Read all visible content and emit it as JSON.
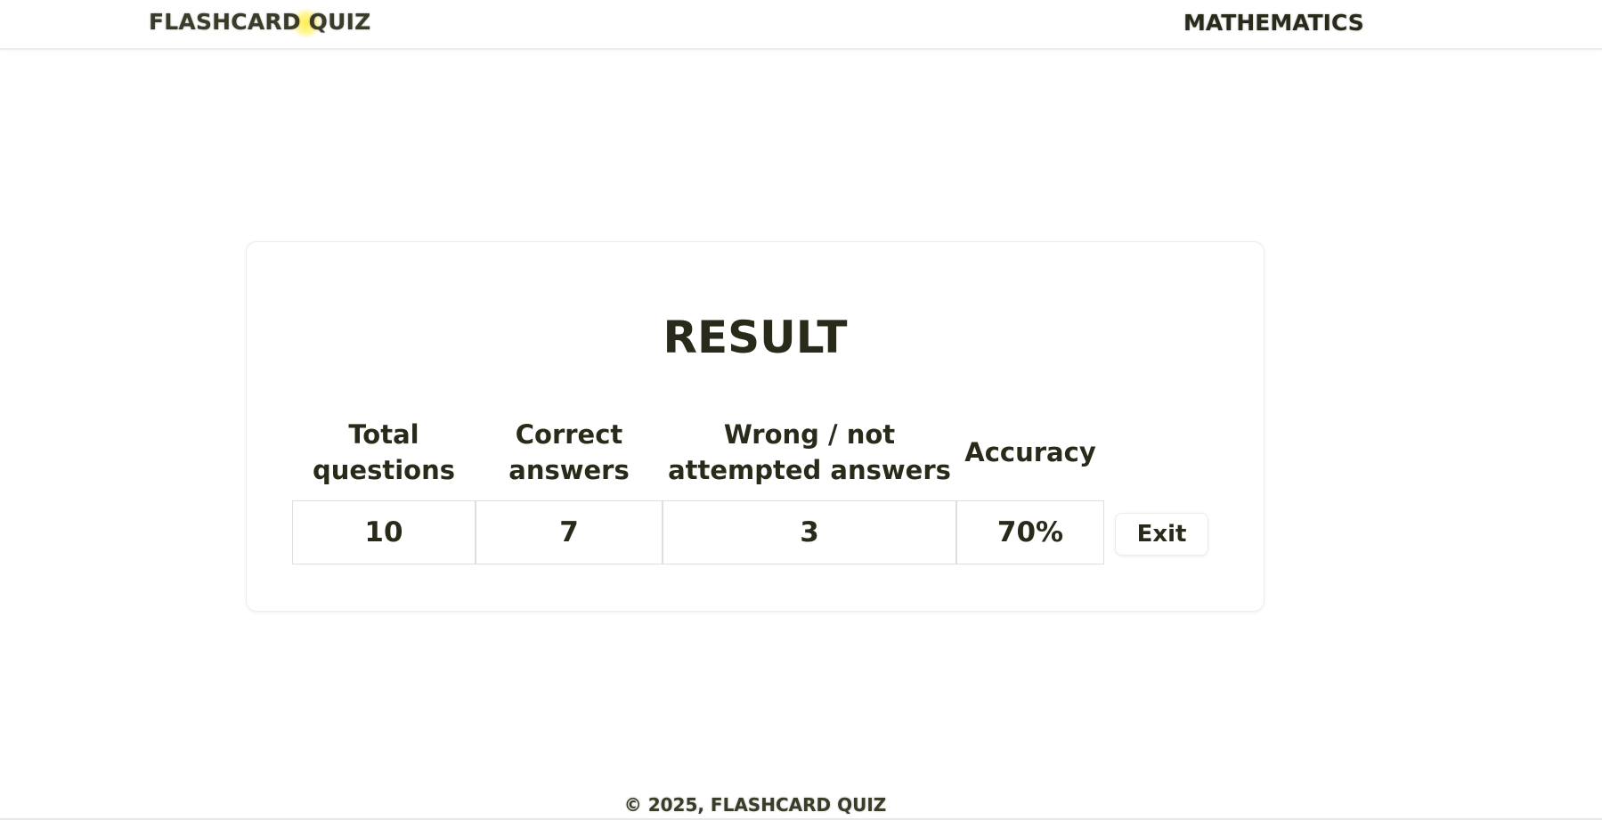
{
  "header": {
    "brand": "FLASHCARD QUIZ",
    "subject": "MATHEMATICS",
    "brand_accent": "#ffee46"
  },
  "result": {
    "title": "RESULT",
    "columns": {
      "total_line1": "Total",
      "total_line2": "questions",
      "correct_line1": "Correct",
      "correct_line2": "answers",
      "wrong_line1": "Wrong / not",
      "wrong_line2": "attempted answers",
      "accuracy": "Accuracy"
    },
    "values": {
      "total": "10",
      "correct": "7",
      "wrong": "3",
      "accuracy": "70%"
    },
    "exit_label": "Exit"
  },
  "footer": {
    "text": "© 2025, FLASHCARD QUIZ"
  }
}
